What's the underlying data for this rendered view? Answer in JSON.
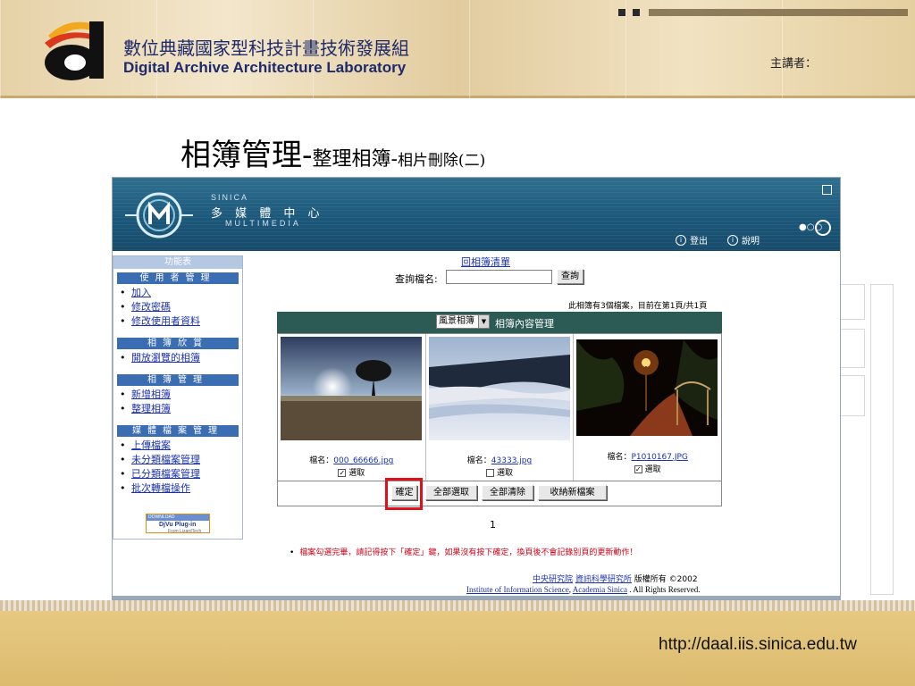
{
  "slide": {
    "org_cn": "數位典藏國家型科技計畫技術發展組",
    "org_en": "Digital Archive Architecture Laboratory",
    "speaker_label": "主講者：",
    "title_main": "相簿管理-",
    "title_sub": "整理相簿-",
    "title_detail": "相片刪除(二)",
    "footer_url": "http://daal.iis.sinica.edu.tw"
  },
  "banner": {
    "sinica": "SINICA",
    "center_cn": "多 媒 體 中 心",
    "center_en": "MULTIMEDIA",
    "logout_label": "登出",
    "help_label": "說明"
  },
  "sidebar": {
    "top_label": "功能表",
    "sections": [
      {
        "title": "使用者管理",
        "items": [
          "加入",
          "修改密碼",
          "修改使用者資料"
        ]
      },
      {
        "title": "相簿欣賞",
        "items": [
          "開放瀏覽的相簿"
        ]
      },
      {
        "title": "相簿管理",
        "items": [
          "新增相簿",
          "整理相簿"
        ]
      },
      {
        "title": "媒體檔案管理",
        "items": [
          "上傳檔案",
          "未分類檔案管理",
          "已分類檔案管理",
          "批次轉檔操作"
        ]
      }
    ],
    "plugin_top": "DOWNLOAD",
    "plugin_main": "DjVu Plug-in",
    "plugin_sub": "From LizardTech"
  },
  "main": {
    "back_link": "回相簿清單",
    "query_label": "查詢檔名:",
    "query_value": "",
    "query_button": "查詢",
    "page_info": "此相簿有3個檔案，目前在第1頁/共1頁",
    "album_select": "風景相簿",
    "album_title": "相簿內容管理",
    "filename_label": "檔名：",
    "select_label": "選取",
    "photos": [
      {
        "filename": "000_66666.jpg",
        "checked": "✓"
      },
      {
        "filename": "43333.jpg",
        "checked": ""
      },
      {
        "filename": "P1010167.JPG",
        "checked": "✓"
      }
    ],
    "buttons": {
      "confirm": "確定",
      "select_all": "全部選取",
      "clear_all": "全部清除",
      "collect_new": "收納新檔案"
    },
    "page_number": "1",
    "notice": "檔案勾選完畢，請記得按下「確定」鍵，如果沒有按下確定，換頁後不會記錄別頁的更新動作！",
    "copyright": {
      "org1": "中央研究院",
      "org2": "資訊科學研究所",
      "rights_cn": "版權所有 ©2002",
      "inst_en": "Institute of Information Science",
      "sep": ",",
      "academia": "Academia Sinica",
      "rights_en": ". All Rights Reserved."
    }
  },
  "colors": {
    "banner": "#1b5679",
    "sidebar_header": "#3b6db3",
    "album_header": "#2c5a54",
    "highlight": "#e0101a",
    "footer": "#dcbb6e"
  }
}
